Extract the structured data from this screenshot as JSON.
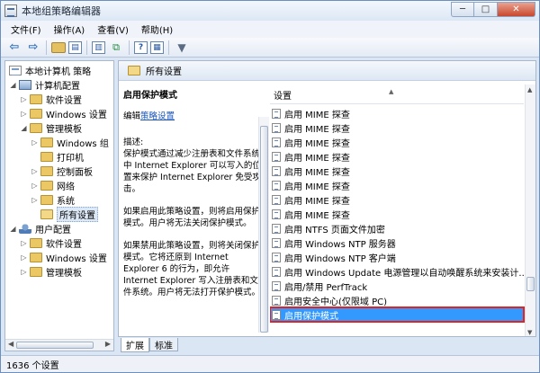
{
  "window": {
    "title": "本地组策略编辑器"
  },
  "window_buttons": {
    "minimize": "─",
    "maximize": "□",
    "close": "✕"
  },
  "menu": [
    "文件(F)",
    "操作(A)",
    "查看(V)",
    "帮助(H)"
  ],
  "tree": {
    "nodes": [
      {
        "label": "本地计算机 策略",
        "icon": "policy-icon",
        "expander": ""
      },
      {
        "label": "计算机配置",
        "icon": "computer-icon",
        "expander": "◢"
      },
      {
        "label": "软件设置",
        "icon": "folder-icon",
        "expander": "▷"
      },
      {
        "label": "Windows 设置",
        "icon": "folder-icon",
        "expander": "▷"
      },
      {
        "label": "管理模板",
        "icon": "folder-icon",
        "expander": "◢"
      },
      {
        "label": "Windows 组",
        "icon": "folder-icon",
        "expander": "▷"
      },
      {
        "label": "打印机",
        "icon": "folder-icon",
        "expander": ""
      },
      {
        "label": "控制面板",
        "icon": "folder-icon",
        "expander": "▷"
      },
      {
        "label": "网络",
        "icon": "folder-icon",
        "expander": "▷"
      },
      {
        "label": "系统",
        "icon": "folder-icon",
        "expander": "▷"
      },
      {
        "label": "所有设置",
        "icon": "open-folder-icon",
        "expander": ""
      },
      {
        "label": "用户配置",
        "icon": "user-icon",
        "expander": "◢"
      },
      {
        "label": "软件设置",
        "icon": "folder-icon",
        "expander": "▷"
      },
      {
        "label": "Windows 设置",
        "icon": "folder-icon",
        "expander": "▷"
      },
      {
        "label": "管理模板",
        "icon": "folder-icon",
        "expander": "▷"
      }
    ],
    "selected_index": 10
  },
  "right": {
    "header": "所有设置",
    "description": {
      "title": "启用保护模式",
      "edit_prefix": "编辑",
      "edit_link": "策略设置",
      "p1": "描述:\n保护模式通过减少注册表和文件系统中 Internet Explorer 可以写入的位置来保护 Internet Explorer 免受攻击。",
      "p2": "如果启用此策略设置，则将启用保护模式。用户将无法关闭保护模式。",
      "p3": "如果禁用此策略设置，则将关闭保护模式。它将还原到 Internet Explorer 6 的行为，即允许 Internet Explorer 写入注册表和文件系统。用户将无法打开保护模式。"
    },
    "list": {
      "column": "设置",
      "rows": [
        "启用 MIME 探查",
        "启用 MIME 探查",
        "启用 MIME 探查",
        "启用 MIME 探查",
        "启用 MIME 探查",
        "启用 MIME 探查",
        "启用 MIME 探查",
        "启用 MIME 探查",
        "启用 NTFS 页面文件加密",
        "启用 Windows NTP 服务器",
        "启用 Windows NTP 客户端",
        "启用 Windows Update 电源管理以自动唤醒系统来安装计...",
        "启用/禁用 PerfTrack",
        "启用安全中心(仅限域 PC)",
        "启用保护模式"
      ],
      "selected_index": 14
    }
  },
  "tabs": [
    "扩展",
    "标准"
  ],
  "status": "1636 个设置"
}
